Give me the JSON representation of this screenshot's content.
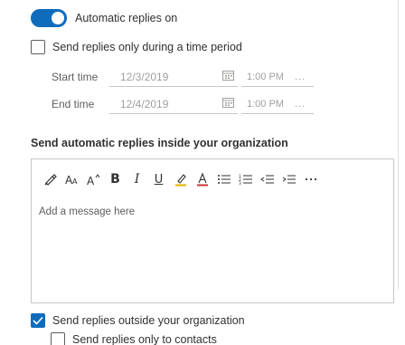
{
  "auto_reply": {
    "toggle_label": "Automatic replies on",
    "enabled": true
  },
  "time_period": {
    "checkbox_label": "Send replies only during a time period",
    "checked": false
  },
  "start": {
    "label": "Start time",
    "date": "12/3/2019",
    "time": "1:00 PM",
    "more": "..."
  },
  "end": {
    "label": "End time",
    "date": "12/4/2019",
    "time": "1:00 PM",
    "more": "..."
  },
  "inside": {
    "title": "Send automatic replies inside your organization",
    "placeholder": "Add a message here",
    "toolbar": [
      {
        "name": "format-painter-icon"
      },
      {
        "name": "font-size-icon"
      },
      {
        "name": "increase-font-icon"
      },
      {
        "name": "bold-icon",
        "text": "B"
      },
      {
        "name": "italic-icon",
        "text": "I"
      },
      {
        "name": "underline-icon",
        "text": "U"
      },
      {
        "name": "highlight-icon"
      },
      {
        "name": "font-color-icon"
      },
      {
        "name": "bullets-icon"
      },
      {
        "name": "numbering-icon"
      },
      {
        "name": "decrease-indent-icon"
      },
      {
        "name": "increase-indent-icon"
      },
      {
        "name": "more-options-icon"
      }
    ]
  },
  "outside": {
    "checkbox_label": "Send replies outside your organization",
    "checked": true
  },
  "contacts": {
    "checkbox_label": "Send replies only to contacts",
    "checked": false
  },
  "colors": {
    "accent": "#0f6cbd",
    "border": "#c8c6c4"
  }
}
